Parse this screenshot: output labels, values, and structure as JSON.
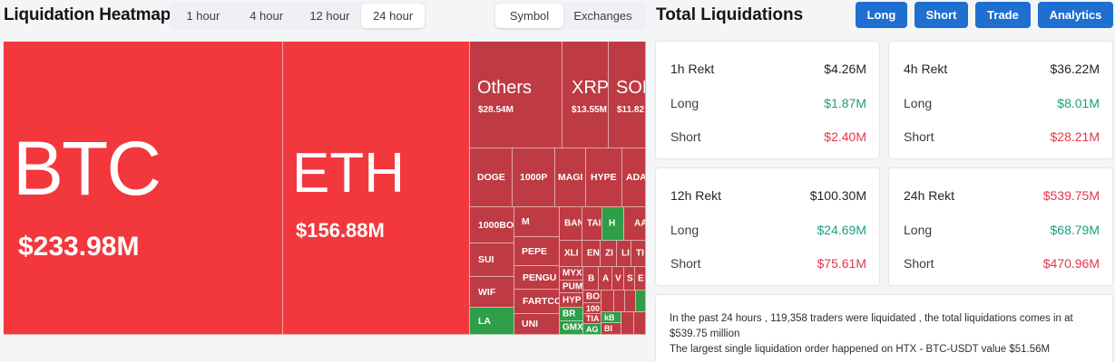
{
  "heatmap": {
    "title": "Liquidation Heatmap",
    "timeframes": [
      "1 hour",
      "4 hour",
      "12 hour",
      "24 hour"
    ],
    "view_options": [
      "Symbol",
      "Exchanges"
    ],
    "tiles": {
      "btc": {
        "symbol": "BTC",
        "value": "$233.98M"
      },
      "eth": {
        "symbol": "ETH",
        "value": "$156.88M"
      },
      "others": {
        "symbol": "Others",
        "value": "$28.54M"
      },
      "xrp": {
        "symbol": "XRP",
        "value": "$13.55M"
      },
      "sol": {
        "symbol": "SOL",
        "value": "$11.82"
      },
      "doge": "DOGE",
      "k1000p": "1000P",
      "magic": "MAGI",
      "hype": "HYPE",
      "ada": "ADA",
      "k1000bo": "1000BO",
      "m": "M",
      "ban": "BAN",
      "tai": "TAI",
      "h": "H",
      "aa": "AA",
      "sui": "SUI",
      "pepe": "PEPE",
      "xl": "XLI",
      "en": "EN",
      "zi": "ZI",
      "li": "LI",
      "tr": "TI",
      "wif": "WIF",
      "pengu": "PENGU",
      "myx": "MYX",
      "pum": "PUM",
      "b1": "B",
      "a1": "A",
      "v1": "V",
      "s1": "S",
      "e1": "E",
      "fartco": "FARTCO",
      "hyp": "HYP",
      "bo": "BO",
      "k100": "100",
      "tia": "TIA",
      "la": "LA",
      "uni": "UNI",
      "br": "BR",
      "gmx": "GMX",
      "ag": "AG",
      "kb": "kB",
      "bi": "BI"
    }
  },
  "total": {
    "title": "Total Liquidations",
    "buttons": [
      "Long",
      "Short",
      "Trade",
      "Analytics"
    ],
    "cards": [
      {
        "title": "1h Rekt",
        "total": "$4.26M",
        "long_label": "Long",
        "long": "$1.87M",
        "short_label": "Short",
        "short": "$2.40M"
      },
      {
        "title": "4h Rekt",
        "total": "$36.22M",
        "long_label": "Long",
        "long": "$8.01M",
        "short_label": "Short",
        "short": "$28.21M"
      },
      {
        "title": "12h Rekt",
        "total": "$100.30M",
        "long_label": "Long",
        "long": "$24.69M",
        "short_label": "Short",
        "short": "$75.61M"
      },
      {
        "title": "24h Rekt",
        "total": "$539.75M",
        "long_label": "Long",
        "long": "$68.79M",
        "short_label": "Short",
        "short": "$470.96M"
      }
    ],
    "summary": {
      "line1": "In the past 24 hours , 119,358 traders were liquidated , the total liquidations comes in at $539.75 million",
      "line2": "The largest single liquidation order happened on HTX - BTC-USDT value $51.56M"
    }
  },
  "colors": {
    "liq_red": "#f2373d",
    "liq_dark_red": "#be3b44",
    "liq_green": "#2e9e48",
    "accent_blue": "#1f6fd1",
    "long_green": "#1a9e7f",
    "short_red": "#e0384a"
  }
}
